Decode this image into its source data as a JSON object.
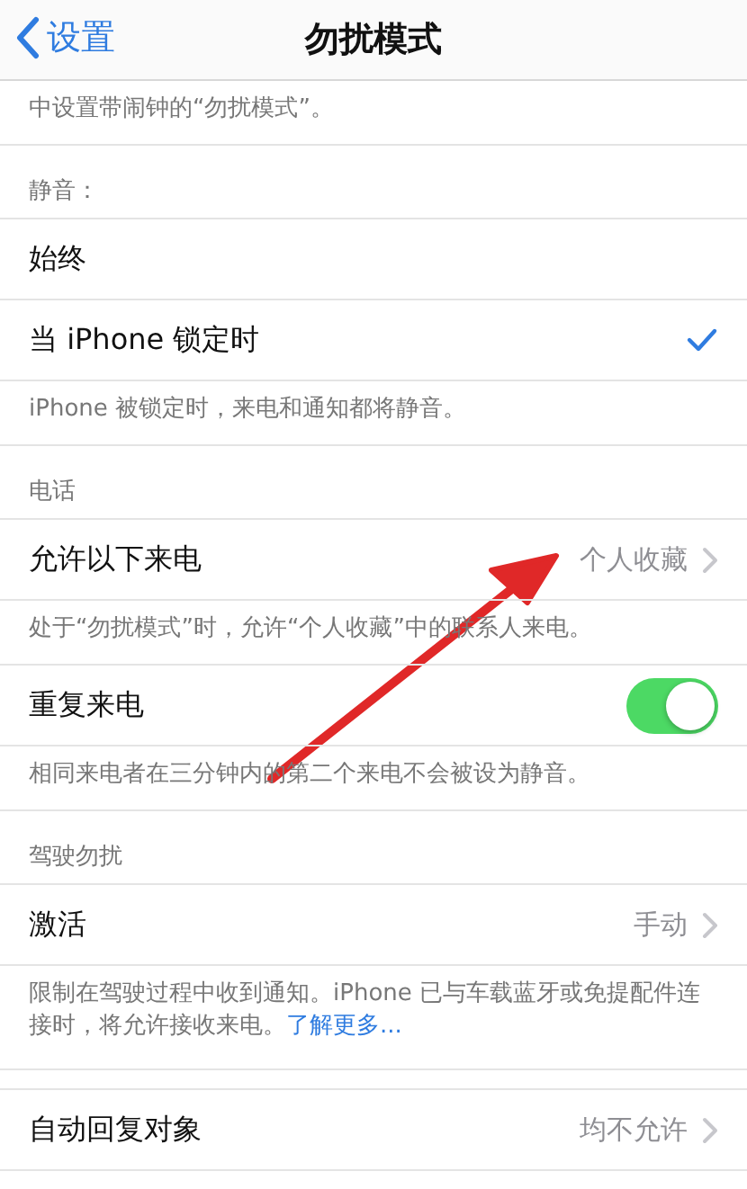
{
  "nav": {
    "back": "设置",
    "title": "勿扰模式"
  },
  "blocks": [
    {
      "kind": "footer",
      "text": "中设置带闹钟的“勿扰模式”。"
    },
    {
      "kind": "header",
      "text": "静音："
    },
    {
      "kind": "row",
      "label": "始终",
      "checked": false
    },
    {
      "kind": "row",
      "label": "当 iPhone 锁定时",
      "checked": true
    },
    {
      "kind": "footer",
      "text": "iPhone 被锁定时，来电和通知都将静音。"
    },
    {
      "kind": "header",
      "text": "电话"
    },
    {
      "kind": "row",
      "label": "允许以下来电",
      "value": "个人收藏"
    },
    {
      "kind": "footer",
      "text": "处于“勿扰模式”时，允许“个人收藏”中的联系人来电。"
    },
    {
      "kind": "row",
      "label": "重复来电",
      "on": true
    },
    {
      "kind": "footer",
      "text": "相同来电者在三分钟内的第二个来电不会被设为静音。"
    },
    {
      "kind": "header",
      "text": "驾驶勿扰"
    },
    {
      "kind": "row",
      "label": "激活",
      "value": "手动"
    },
    {
      "kind": "footer",
      "text": "限制在驾驶过程中收到通知。iPhone 已与车载蓝牙或免提配件连接时，将允许接收来电。",
      "link": "了解更多..."
    },
    {
      "kind": "row",
      "label": "自动回复对象",
      "value": "均不允许"
    }
  ],
  "annotations": [
    {
      "kind": "arrow",
      "color": "#e02828"
    }
  ]
}
